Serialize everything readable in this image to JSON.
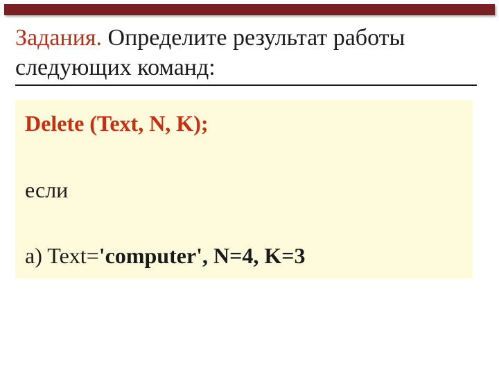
{
  "heading": {
    "accent": "Задания",
    "dot": ".",
    "rest": " Определите результат работы следующих команд:"
  },
  "code": {
    "line1": "Delete (Text, N, K);",
    "line2": "если",
    "line3_prefix": "a) Text=",
    "line3_bold": "'computer',  N=4, K=3"
  }
}
